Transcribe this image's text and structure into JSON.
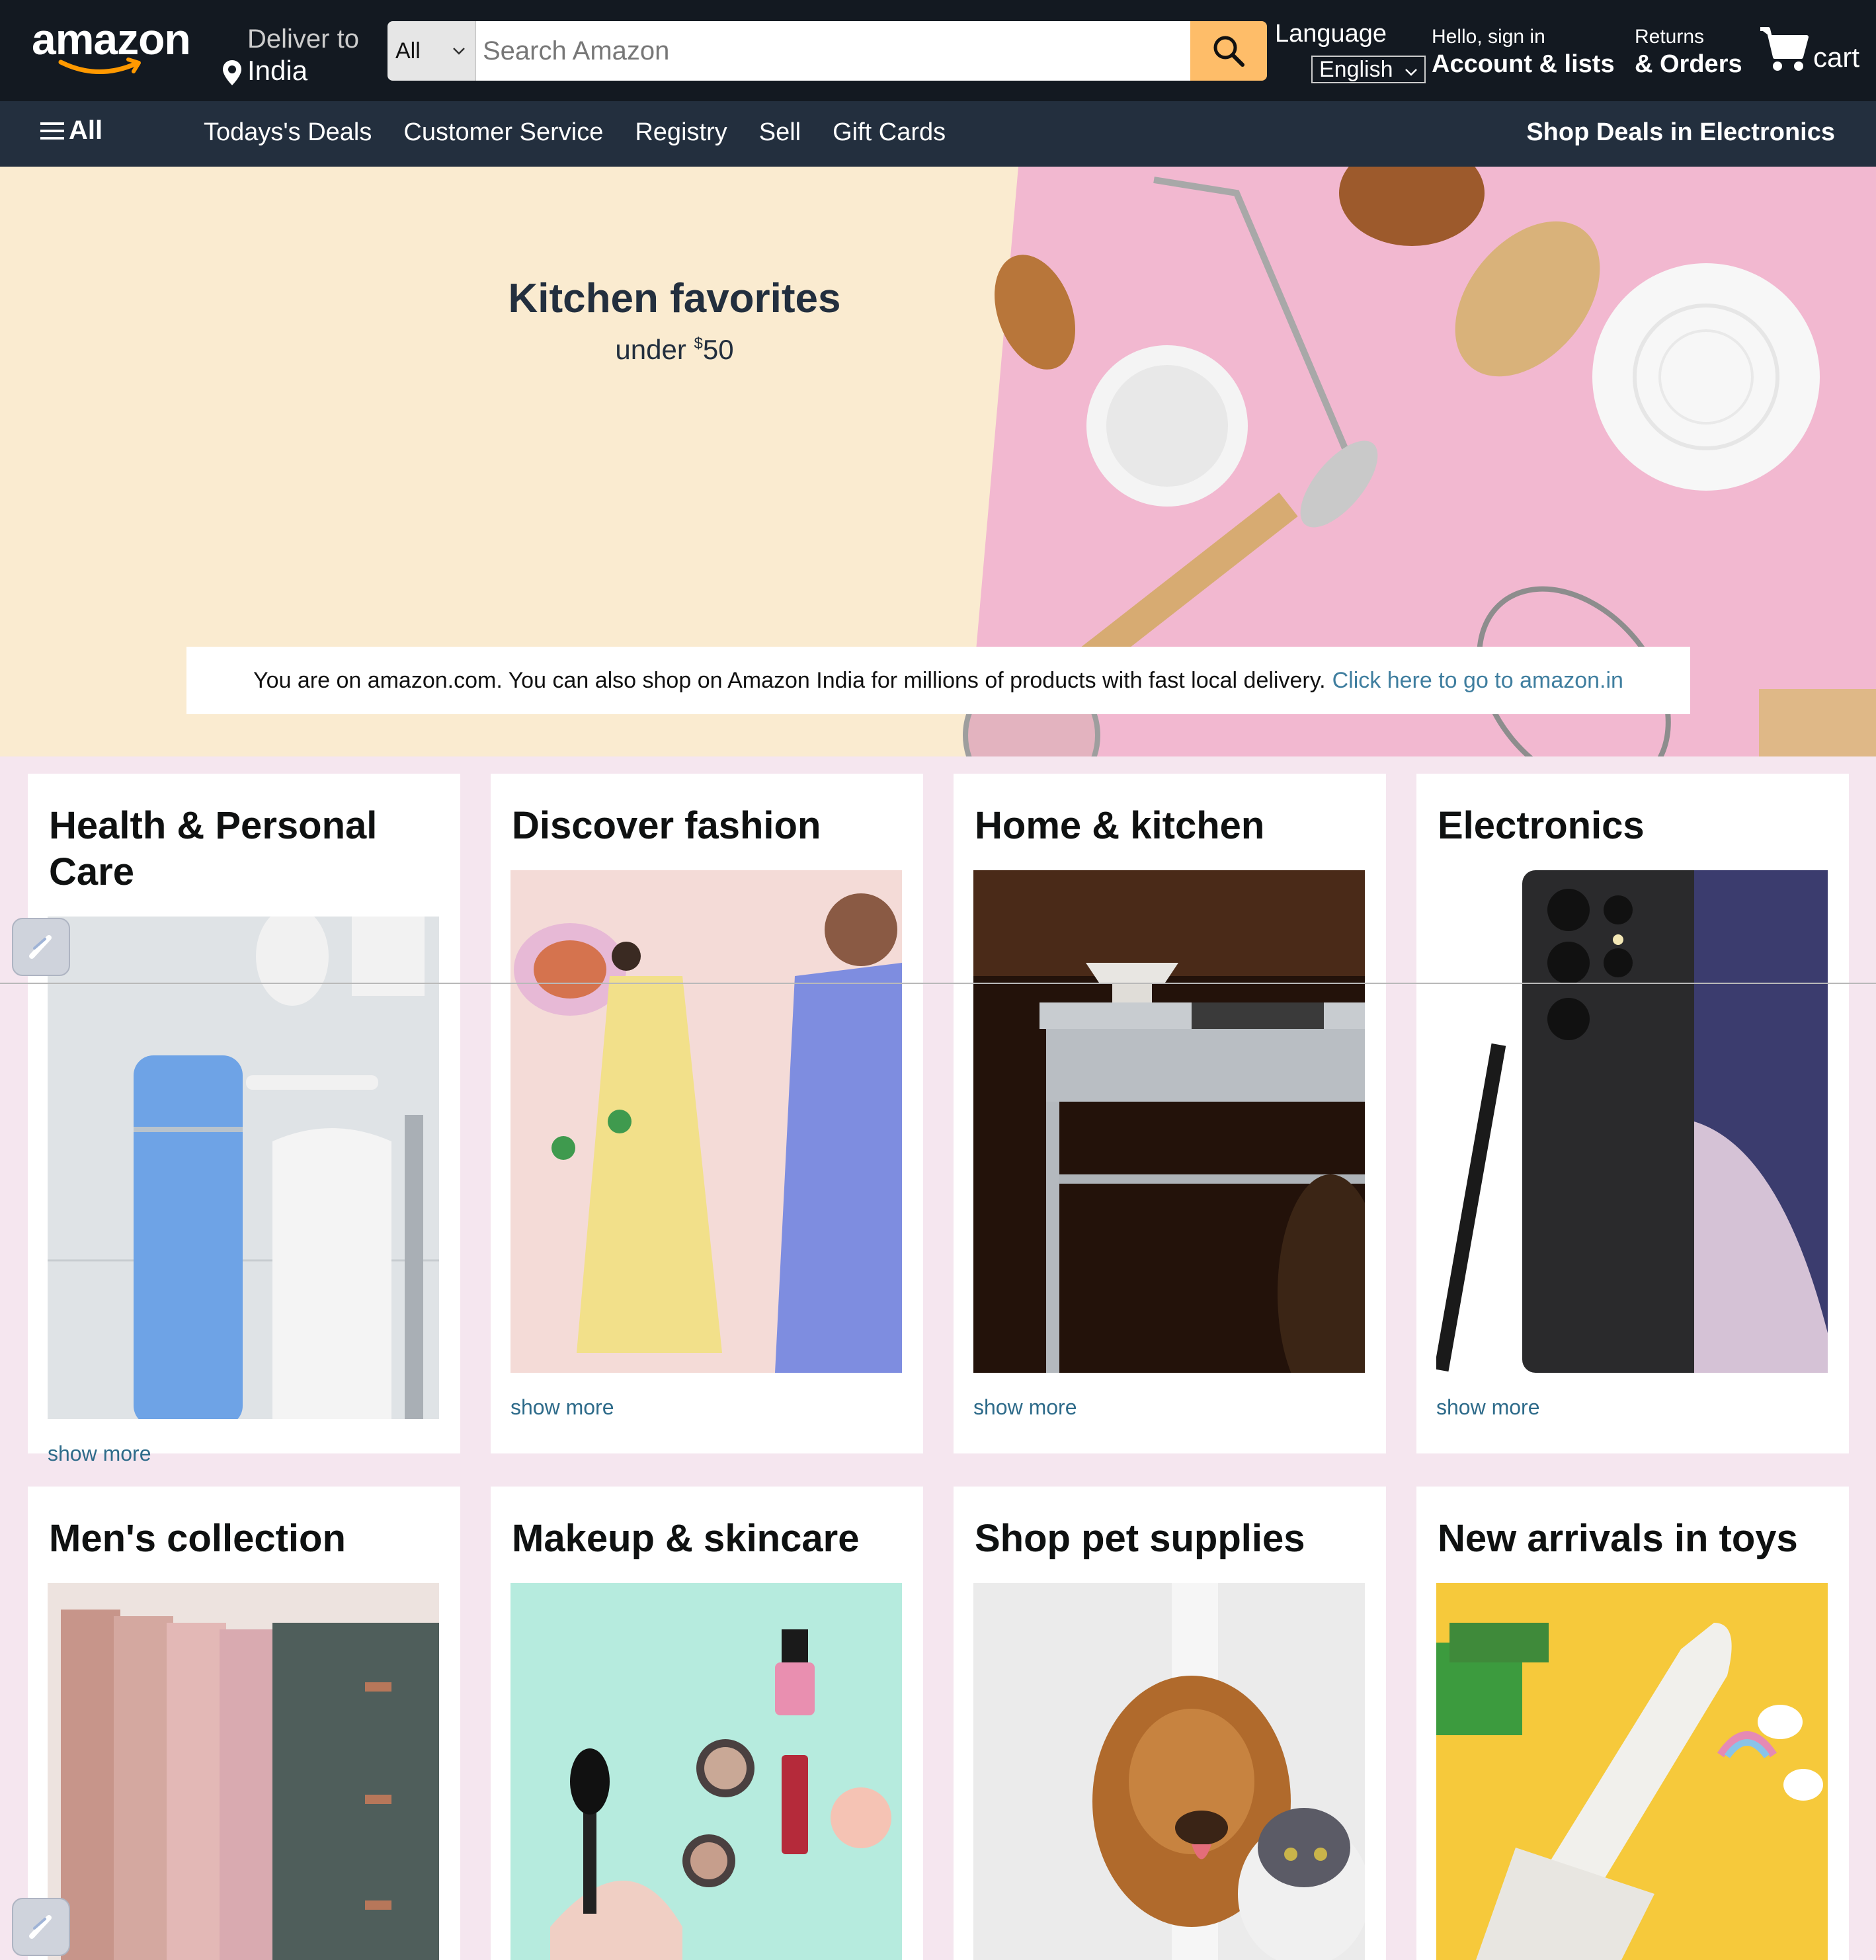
{
  "header": {
    "logo_text": "amazon",
    "deliver_line1": "Deliver to",
    "deliver_line2": "India",
    "search_category": "All",
    "search_placeholder": "Search Amazon",
    "language_label": "Language",
    "language_value": "English",
    "account_line1": "Hello, sign in",
    "account_line2": "Account & lists",
    "orders_line1": "Returns",
    "orders_line2": "& Orders",
    "cart_label": "cart"
  },
  "subnav": {
    "all_label": "All",
    "links": [
      "Todays's Deals",
      "Customer Service",
      "Registry",
      "Sell",
      "Gift Cards"
    ],
    "right_link": "Shop Deals in Electronics"
  },
  "hero": {
    "title": "Kitchen favorites",
    "subtitle_prefix": "under ",
    "subtitle_currency": "$",
    "subtitle_amount": "50",
    "notice_text": "You are on amazon.com. You can also shop on Amazon India for millions of products with fast local delivery.",
    "notice_link": "Click here to go to amazon.in"
  },
  "cards": [
    {
      "title": "Health & Personal Care",
      "more": "show more"
    },
    {
      "title": "Discover fashion",
      "more": "show more"
    },
    {
      "title": "Home & kitchen",
      "more": "show more"
    },
    {
      "title": "Electronics",
      "more": "show more"
    },
    {
      "title": "Men's collection",
      "more": ""
    },
    {
      "title": "Makeup & skincare",
      "more": ""
    },
    {
      "title": "Shop pet supplies",
      "more": ""
    },
    {
      "title": "New arrivals in toys",
      "more": ""
    }
  ],
  "colors": {
    "nav_bg": "#131921",
    "subnav_bg": "#232f3e",
    "search_button": "#febd69",
    "link": "#2e6b8a",
    "page_bg": "#f5e6ef"
  },
  "icons": [
    "location-pin-icon",
    "dropdown-caret-icon",
    "search-icon",
    "cart-icon",
    "hamburger-icon",
    "pen-edit-icon"
  ]
}
